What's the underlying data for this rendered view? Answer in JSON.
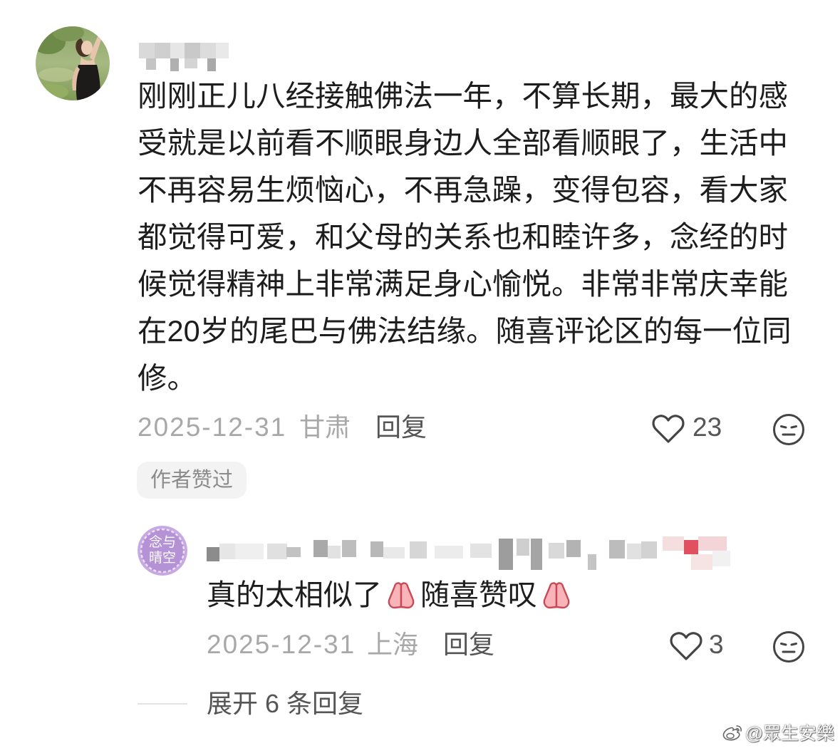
{
  "comment": {
    "lines": [
      "刚刚正儿八经接触佛法一年，不算长期，最大的感",
      "受就是以前看不顺眼身边人全部看顺眼了，生活中",
      "不再容易生烦恼心，不再急躁，变得包容，看大家",
      "都觉得可爱，和父母的关系也和睦许多，念经的时",
      "候觉得精神上非常满足身心愉悦。非常非常庆幸能",
      "在20岁的尾巴与佛法结缘。随喜评论区的每一位同",
      "修。"
    ],
    "date": "2025-12-31",
    "location": "甘肃",
    "reply_label": "回复",
    "like_icon": "heart-outline-icon",
    "likes": "23",
    "dislike_icon": "unamused-face-icon",
    "author_badge": "作者赞过"
  },
  "reply": {
    "avatar_text": [
      "念与",
      "晴空"
    ],
    "text_parts": [
      "真的太相似了",
      "随喜赞叹"
    ],
    "emoji_icon": "praying-hands-icon",
    "date": "2025-12-31",
    "location": "上海",
    "reply_label": "回复",
    "like_icon": "heart-outline-icon",
    "likes": "3",
    "dislike_icon": "unamused-face-icon"
  },
  "expand_label": "展开 6 条回复",
  "watermark": {
    "icon": "weibo-logo-icon",
    "text": "@眾生安樂"
  },
  "colors": {
    "text": "#1d1d1d",
    "meta": "#a8a8a8",
    "action": "#555555",
    "badge_bg": "#f3f3f3",
    "reply_avatar": "#b591d6",
    "emoji_fill": "#f8b4b8",
    "emoji_outline": "#c94a56"
  }
}
